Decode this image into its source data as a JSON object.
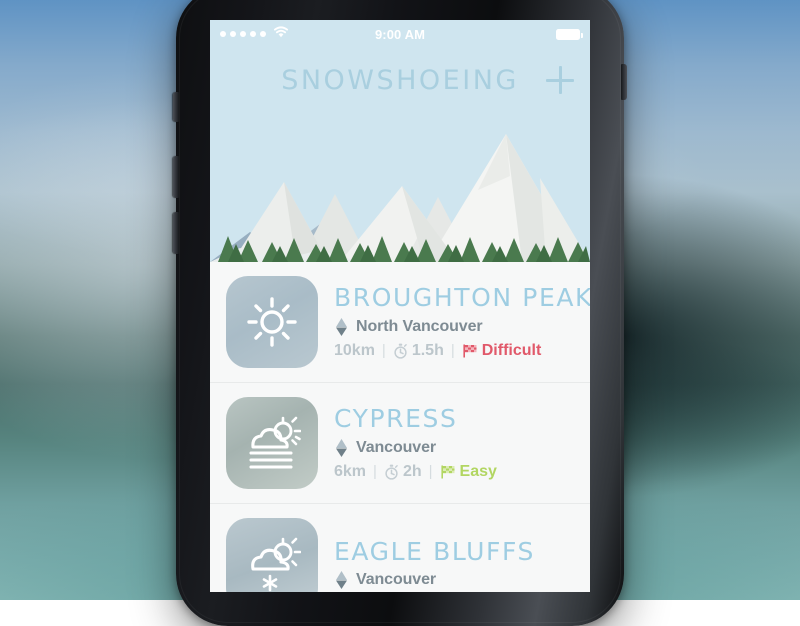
{
  "status_bar": {
    "signal_dots": 5,
    "wifi_icon": "wifi-icon",
    "time": "9:00 AM",
    "battery_icon": "battery-full-icon"
  },
  "header": {
    "title": "SNOWSHOEING",
    "add_label": "+",
    "add_icon": "plus-icon",
    "background_color": "#cfe5ef",
    "title_color": "#a9cfdf"
  },
  "hero": {
    "illustration": "snowy-mountains-with-pine-trees",
    "sky_color": "#cfe5ef",
    "snow_color": "#f2f3f2",
    "rock_color": "#93a8b8",
    "tree_color": "#4a7a4e"
  },
  "trails": [
    {
      "name": "BROUGHTON PEAK",
      "weather_icon": "sun-icon",
      "location_icon": "mountain-marker-icon",
      "location": "North Vancouver",
      "distance": "10km",
      "separator": "|",
      "time_icon": "stopwatch-icon",
      "time": "1.5h",
      "difficulty_icon": "flag-icon",
      "difficulty": "Difficult",
      "difficulty_color": "#e1596a"
    },
    {
      "name": "CYPRESS",
      "weather_icon": "sun-cloud-fog-icon",
      "location_icon": "mountain-marker-icon",
      "location": "Vancouver",
      "distance": "6km",
      "separator": "|",
      "time_icon": "stopwatch-icon",
      "time": "2h",
      "difficulty_icon": "flag-icon",
      "difficulty": "Easy",
      "difficulty_color": "#b2d662"
    },
    {
      "name": "EAGLE BLUFFS",
      "weather_icon": "sun-cloud-snow-icon",
      "location_icon": "mountain-marker-icon",
      "location": "Vancouver",
      "distance": "",
      "separator": "",
      "time_icon": "",
      "time": "",
      "difficulty_icon": "",
      "difficulty": "",
      "difficulty_color": ""
    }
  ]
}
